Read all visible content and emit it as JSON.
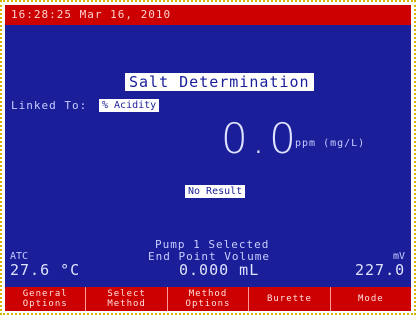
{
  "header": {
    "datetime": "16:28:25 Mar 16, 2010"
  },
  "method": {
    "title": "Salt Determination"
  },
  "linked": {
    "label": "Linked To:",
    "value": "% Acidity"
  },
  "result": {
    "value": "0.0",
    "unit": "ppm (mg/L)",
    "status": "No Result"
  },
  "pump": {
    "text": "Pump 1 Selected"
  },
  "endpoint": {
    "label": "End Point Volume",
    "value": "0.000 mL"
  },
  "atc": {
    "label": "ATC",
    "value": "27.6 °C"
  },
  "mv": {
    "label": "mV",
    "value": "227.0"
  },
  "softkeys": [
    {
      "label": "General\nOptions"
    },
    {
      "label": "Select\nMethod"
    },
    {
      "label": "Method\nOptions"
    },
    {
      "label": "Burette"
    },
    {
      "label": "Mode"
    }
  ]
}
